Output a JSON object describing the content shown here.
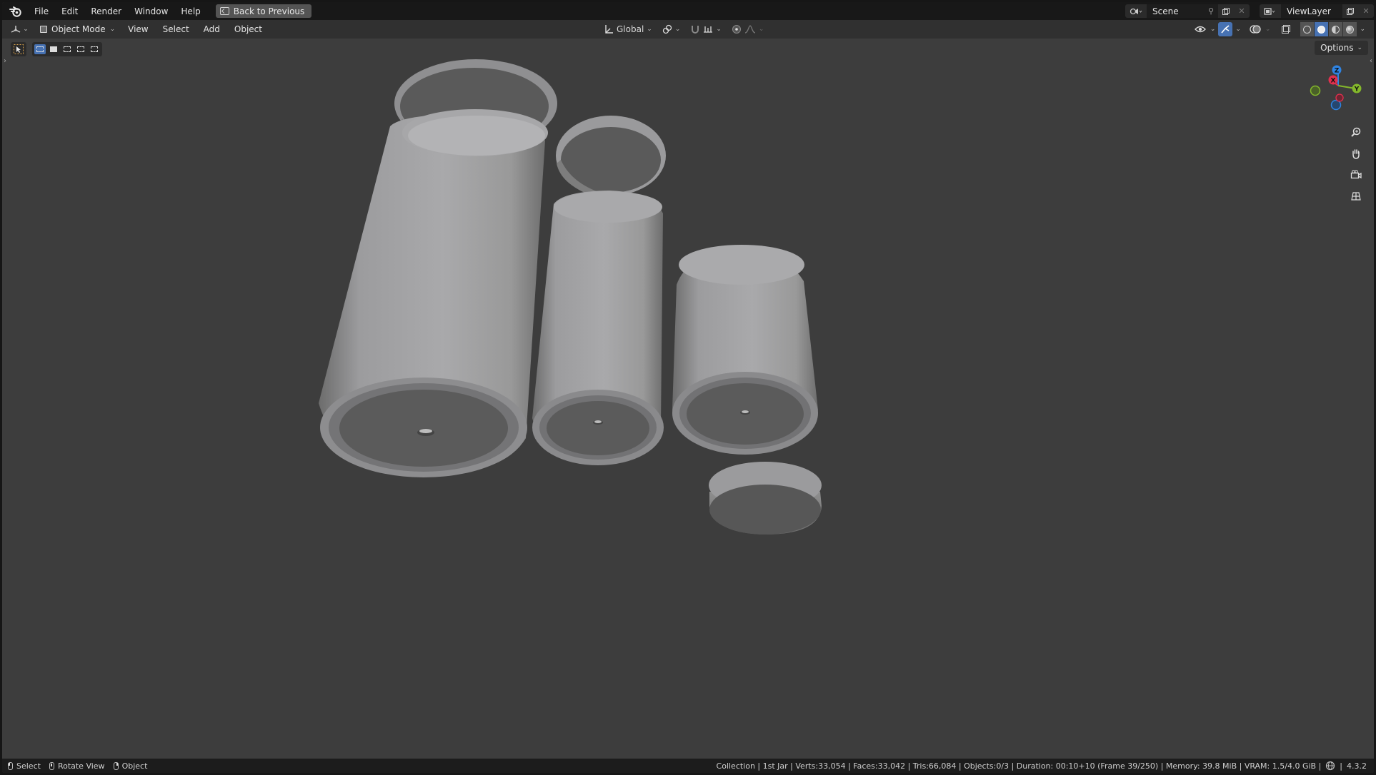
{
  "menubar": {
    "items": [
      "File",
      "Edit",
      "Render",
      "Window",
      "Help"
    ],
    "back_button": "Back to Previous",
    "scene": "Scene",
    "view_layer": "ViewLayer"
  },
  "header": {
    "mode": "Object Mode",
    "menus": [
      "View",
      "Select",
      "Add",
      "Object"
    ],
    "orientation": "Global",
    "options": "Options"
  },
  "gizmo": {
    "x": "X",
    "y": "Y",
    "z": "Z"
  },
  "statusbar": {
    "hints": [
      "Select",
      "Rotate View",
      "Object"
    ],
    "info": "Collection | 1st Jar | Verts:33,054 | Faces:33,042 | Tris:66,084 | Objects:0/3 | Duration: 00:10+10 (Frame 39/250) | Memory: 39.8 MiB | VRAM: 1.5/4.0 GiB |",
    "version": "4.3.2"
  },
  "colors": {
    "accent": "#4772b3",
    "x_axis": "#e2304e",
    "y_axis": "#84b82b",
    "z_axis": "#2f84e3"
  }
}
